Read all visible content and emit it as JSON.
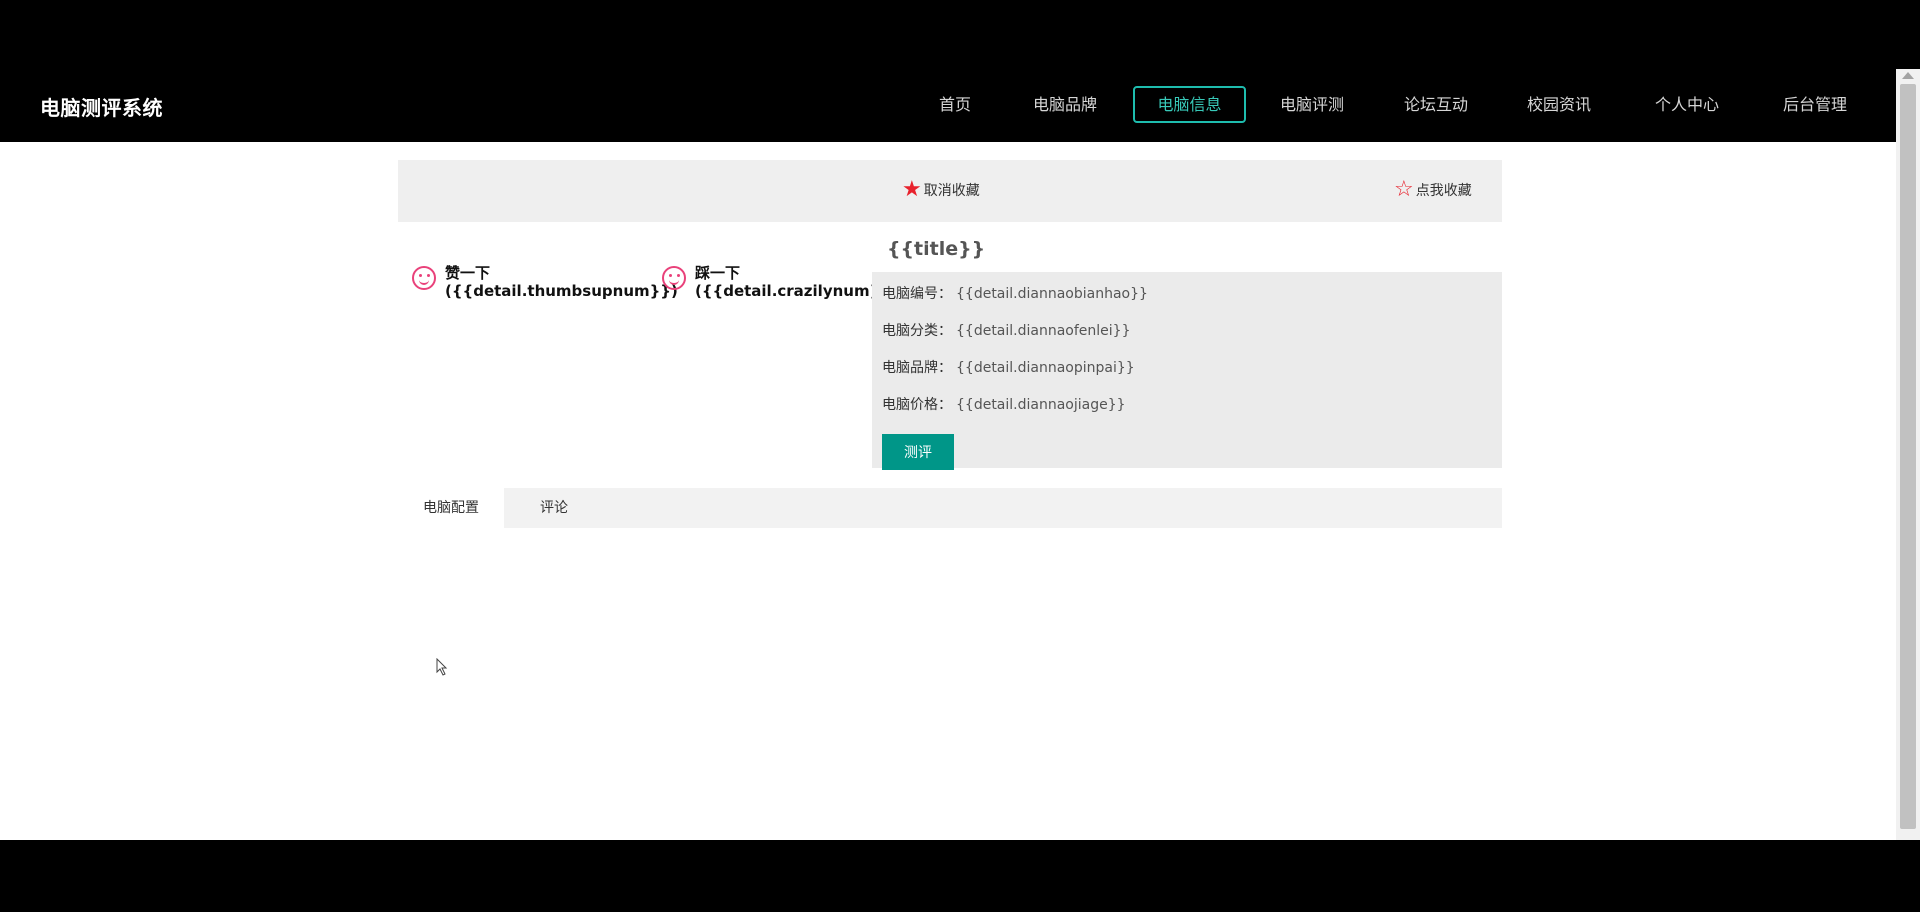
{
  "navbar": {
    "brand": "电脑测评系统",
    "items": [
      {
        "label": "首页"
      },
      {
        "label": "电脑品牌"
      },
      {
        "label": "电脑信息",
        "active": true
      },
      {
        "label": "电脑评测"
      },
      {
        "label": "论坛互动"
      },
      {
        "label": "校园资讯"
      },
      {
        "label": "个人中心"
      },
      {
        "label": "后台管理"
      }
    ]
  },
  "favorites": {
    "cancel_label": "取消收藏",
    "add_label": "点我收藏",
    "cancel_star_color": "#e8212c",
    "add_star_color": "#e8212c"
  },
  "votes": {
    "up_label": "赞一下",
    "up_count": "({{detail.thumbsupnum}})",
    "down_label": "踩一下",
    "down_count": "({{detail.crazilynum}})"
  },
  "detail": {
    "title": "{{title}}",
    "fields": [
      {
        "label": "电脑编号：",
        "value": "{{detail.diannaobianhao}}"
      },
      {
        "label": "电脑分类：",
        "value": "{{detail.diannaofenlei}}"
      },
      {
        "label": "电脑品牌：",
        "value": "{{detail.diannaopinpai}}"
      },
      {
        "label": "电脑价格：",
        "value": "{{detail.diannaojiage}}"
      }
    ],
    "review_button": "测评"
  },
  "tabs": [
    {
      "label": "电脑配置",
      "active": true
    },
    {
      "label": "评论"
    }
  ],
  "colors": {
    "accent": "#009688",
    "nav_active": "#1ebcae"
  }
}
